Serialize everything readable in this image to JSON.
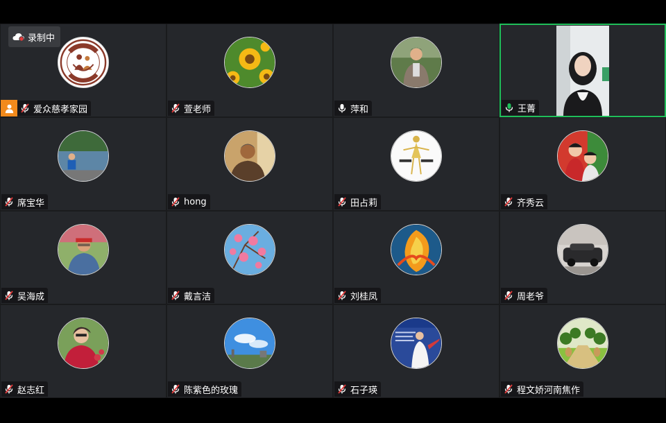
{
  "recording": {
    "label": "录制中"
  },
  "participants": [
    {
      "name": "爱众慈孝家园",
      "mic": "muted",
      "host": true,
      "logo_text": [
        "有为者",
        "分享者",
        "感恩者"
      ],
      "logo_bottom": "爱众慈孝家园"
    },
    {
      "name": "萱老师",
      "mic": "muted"
    },
    {
      "name": "萍和",
      "mic": "on"
    },
    {
      "name": "王菁",
      "mic": "speaking",
      "video": true
    },
    {
      "name": "席宝华",
      "mic": "muted"
    },
    {
      "name": "hong",
      "mic": "muted"
    },
    {
      "name": "田占莉",
      "mic": "muted"
    },
    {
      "name": "齐秀云",
      "mic": "muted"
    },
    {
      "name": "吴海成",
      "mic": "muted"
    },
    {
      "name": "戴言洁",
      "mic": "muted"
    },
    {
      "name": "刘桂凤",
      "mic": "muted"
    },
    {
      "name": "周老爷",
      "mic": "muted"
    },
    {
      "name": "赵志红",
      "mic": "muted"
    },
    {
      "name": "陈紫色的玫瑰",
      "mic": "muted"
    },
    {
      "name": "石子瑛",
      "mic": "muted"
    },
    {
      "name": "程文娇河南焦作",
      "mic": "muted"
    }
  ],
  "colors": {
    "active_border": "#1fbf5a",
    "host_badge": "#f28a1c",
    "muted_slash": "#e23b3b"
  }
}
